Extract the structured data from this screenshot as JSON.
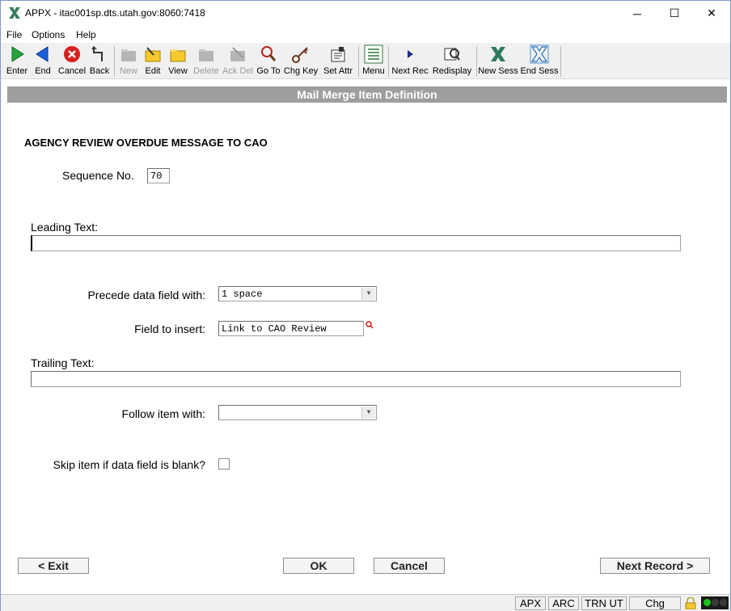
{
  "window": {
    "title": "APPX - itac001sp.dts.utah.gov:8060:7418",
    "app_icon": "appx-x-icon",
    "minimize": "─",
    "maximize": "☐",
    "close": "✕"
  },
  "menu": [
    "File",
    "Options",
    "Help"
  ],
  "toolbar": [
    {
      "label": "Enter",
      "icon": "enter-arrow-icon",
      "enabled": true
    },
    {
      "label": "End",
      "icon": "end-arrow-icon",
      "enabled": true
    },
    {
      "label": "Cancel",
      "icon": "cancel-icon",
      "enabled": true
    },
    {
      "label": "Back",
      "icon": "back-icon",
      "enabled": true
    },
    {
      "label": "New",
      "icon": "new-folder-icon",
      "enabled": false
    },
    {
      "label": "Edit",
      "icon": "edit-folder-icon",
      "enabled": true
    },
    {
      "label": "View",
      "icon": "view-folder-icon",
      "enabled": true
    },
    {
      "label": "Delete",
      "icon": "delete-folder-icon",
      "enabled": false
    },
    {
      "label": "Ack Del",
      "icon": "ack-delete-icon",
      "enabled": false
    },
    {
      "label": "Go To",
      "icon": "magnifier-icon",
      "enabled": true
    },
    {
      "label": "Chg Key",
      "icon": "key-icon",
      "enabled": true
    },
    {
      "label": "Set Attr",
      "icon": "set-attr-icon",
      "enabled": true
    },
    {
      "label": "Menu",
      "icon": "menu-list-icon",
      "enabled": true
    },
    {
      "label": "Next Rec",
      "icon": "next-record-icon",
      "enabled": true
    },
    {
      "label": "Redisplay",
      "icon": "redisplay-icon",
      "enabled": true
    },
    {
      "label": "New Sess",
      "icon": "new-session-icon",
      "enabled": true
    },
    {
      "label": "End Sess",
      "icon": "end-session-icon",
      "enabled": true
    }
  ],
  "form": {
    "header": "Mail Merge Item Definition",
    "heading": "AGENCY REVIEW OVERDUE MESSAGE TO CAO",
    "sequence_label": "Sequence No.",
    "sequence_value": "70",
    "leading_text_label": "Leading Text:",
    "leading_text_value": "",
    "precede_label": "Precede data field with:",
    "precede_value": "1 space",
    "field_insert_label": "Field to insert:",
    "field_insert_value": "Link to CAO Review",
    "trailing_text_label": "Trailing Text:",
    "trailing_text_value": "",
    "follow_label": "Follow item with:",
    "follow_value": "",
    "skip_label": "Skip item if data field is blank?",
    "skip_checked": false
  },
  "buttons": {
    "exit": "< Exit",
    "ok": "OK",
    "cancel": "Cancel",
    "next": "Next Record >"
  },
  "status": {
    "apx": "APX",
    "arc": "ARC",
    "trn": "TRN UT",
    "chg": "Chg"
  }
}
